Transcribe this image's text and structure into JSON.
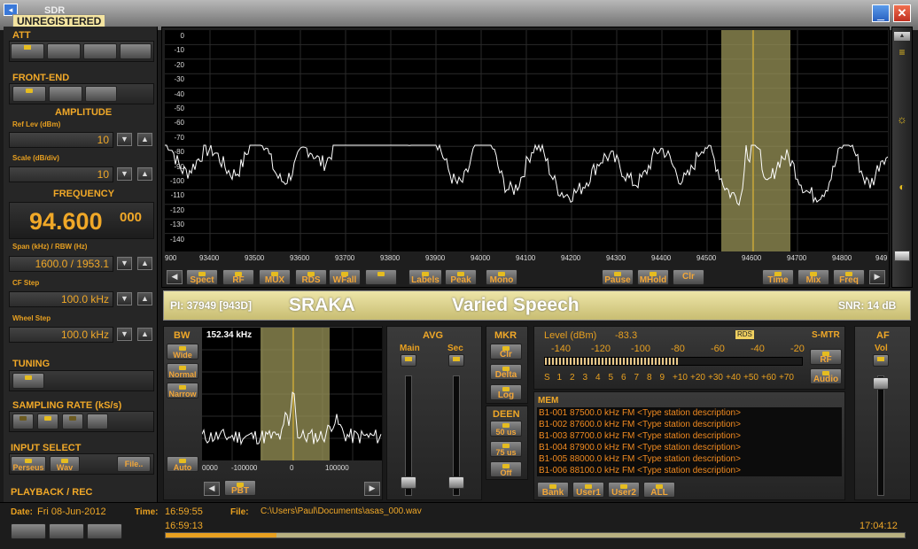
{
  "window": {
    "title": "SDR",
    "unregistered": "UNREGISTERED",
    "minimize_icon": "minimize-icon",
    "close_icon": "close-icon",
    "accent": "#e8a020",
    "background": "#1a1a1a"
  },
  "left": {
    "att": {
      "title": "ATT"
    },
    "frontend": {
      "title": "FRONT-END"
    },
    "amplitude": {
      "title": "AMPLITUDE",
      "ref_label": "Ref Lev (dBm)",
      "ref_value": "10",
      "scale_label": "Scale (dB/div)",
      "scale_value": "10"
    },
    "frequency": {
      "title": "FREQUENCY",
      "main": "94.600",
      "sub": "000",
      "span_label": "Span (kHz) / RBW (Hz)",
      "span_value": "1600.0 / 1953.1",
      "cf_label": "CF Step",
      "cf_value": "100.0 kHz",
      "wheel_label": "Wheel Step",
      "wheel_value": "100.0 kHz"
    },
    "tuning": {
      "title": "TUNING"
    },
    "sampling": {
      "title": "SAMPLING RATE (kS/s)"
    },
    "input": {
      "title": "INPUT SELECT",
      "perseus": "Perseus",
      "wav": "Wav",
      "file": "File.."
    },
    "playback": {
      "title": "PLAYBACK / REC"
    }
  },
  "spectrum": {
    "y_ticks": [
      "0",
      "-10",
      "-20",
      "-30",
      "-40",
      "-50",
      "-60",
      "-70",
      "-80",
      "-90",
      "-100",
      "-110",
      "-120",
      "-130",
      "-140"
    ],
    "x_ticks": [
      "900",
      "93400",
      "93500",
      "93600",
      "93700",
      "93800",
      "93900",
      "94000",
      "94100",
      "94200",
      "94300",
      "94400",
      "94500",
      "94600",
      "94700",
      "94800",
      "949"
    ],
    "buttons": {
      "spect": "Spect",
      "rf": "RF",
      "mux": "MUX",
      "rds": "RDS",
      "wfall": "WFall",
      "labels": "Labels",
      "peak": "Peak",
      "mono": "Mono",
      "pause": "Pause",
      "mhold": "MHold",
      "clr": "Clr",
      "time": "Time",
      "mix": "Mix",
      "freq": "Freq"
    }
  },
  "rds": {
    "pi": "PI: 37949 [943D]",
    "ps": "SRAKA",
    "pty": "Varied Speech",
    "snr": "SNR: 14 dB"
  },
  "bw": {
    "title": "BW",
    "wide": "Wide",
    "normal": "Normal",
    "narrow": "Narrow",
    "auto": "Auto",
    "pbt": "PBT",
    "readout": "152.34 kHz",
    "x_ticks": [
      "0000",
      "-100000",
      "0",
      "100000"
    ]
  },
  "avg": {
    "title": "AVG",
    "main": "Main",
    "sec": "Sec"
  },
  "mkr": {
    "title": "MKR",
    "clr": "Clr",
    "delta": "Delta",
    "log": "Log"
  },
  "deen": {
    "title": "DEEN",
    "us50": "50 us",
    "us75": "75 us",
    "off": "Off"
  },
  "level": {
    "label": "Level (dBm)",
    "value": "-83.3",
    "rds_badge": "RDS",
    "scale_top": [
      "-140",
      "-120",
      "-100",
      "-80",
      "-60",
      "-40",
      "-20"
    ],
    "scale_bottom": [
      "S",
      "1",
      "2",
      "3",
      "4",
      "5",
      "6",
      "7",
      "8",
      "9",
      "+10",
      "+20",
      "+30",
      "+40",
      "+50",
      "+60",
      "+70"
    ],
    "smtr": "S-MTR",
    "rf": "RF",
    "audio": "Audio",
    "fill_ratio": 0.52
  },
  "af": {
    "title": "AF",
    "vol": "Vol"
  },
  "mem": {
    "title": "MEM",
    "entries": [
      "B1-001 87500.0 kHz  FM  <Type station description>",
      "B1-002 87600.0 kHz  FM  <Type station description>",
      "B1-003 87700.0 kHz  FM  <Type station description>",
      "B1-004 87900.0 kHz  FM  <Type station description>",
      "B1-005 88000.0 kHz  FM  <Type station description>",
      "B1-006 88100.0 kHz  FM  <Type station description>"
    ],
    "bank": "Bank",
    "user1": "User1",
    "user2": "User2",
    "all": "ALL"
  },
  "status": {
    "date_label": "Date:",
    "date": "Fri 08-Jun-2012",
    "time_label": "Time:",
    "time": "16:59:55",
    "file_label": "File:",
    "file": "C:\\Users\\Paul\\Documents\\asas_000.wav",
    "pos_start": "16:59:13",
    "pos_end": "17:04:12",
    "progress": 0.15
  }
}
